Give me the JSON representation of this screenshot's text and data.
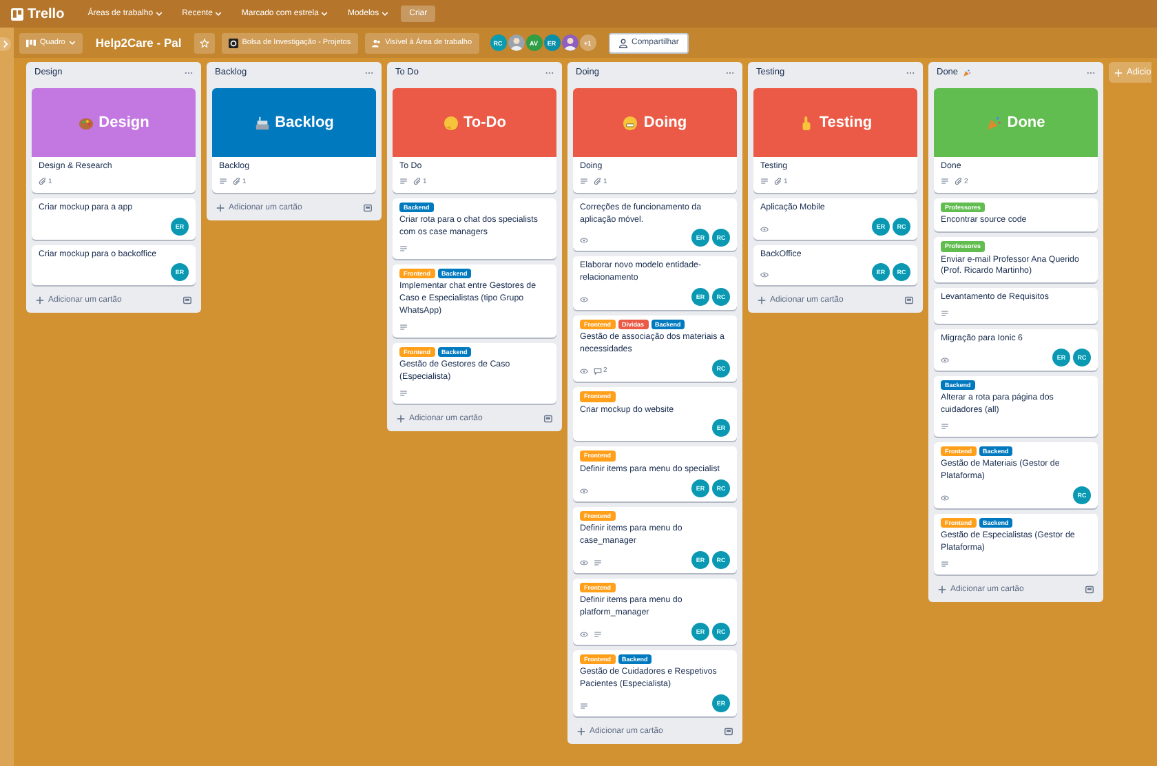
{
  "topbar": {
    "logo": "Trello",
    "menus": [
      {
        "label": "Áreas de trabalho"
      },
      {
        "label": "Recente"
      },
      {
        "label": "Marcado com estrela"
      },
      {
        "label": "Modelos"
      }
    ],
    "create": "Criar"
  },
  "boardbar": {
    "view": "Quadro",
    "title": "Help2Care - Pal",
    "starred": false,
    "workspace": "Bolsa de Investigação - Projetos",
    "visibility": "Visível à Área de trabalho",
    "members": [
      {
        "kind": "initials",
        "initials": "RC",
        "color": "#0a9bb0"
      },
      {
        "kind": "photo",
        "color": "#9aa3ad"
      },
      {
        "kind": "initials",
        "initials": "AV",
        "color": "#2f9e44"
      },
      {
        "kind": "initials",
        "initials": "ER",
        "color": "#0a8fa8"
      },
      {
        "kind": "photo",
        "color": "#8e5fc0"
      }
    ],
    "more": "+1",
    "share": "Compartilhar"
  },
  "lists": [
    {
      "title": "Design",
      "add": "Adicionar um cartão",
      "cards": [
        {
          "cover": {
            "color": "#c377e0",
            "title": "Design"
          },
          "title": "Design & Research",
          "badges": [
            {
              "kind": "attachments",
              "count": "1"
            }
          ]
        },
        {
          "title": "Criar mockup para a app",
          "members": [
            "ER"
          ]
        },
        {
          "title": "Criar mockup para o backoffice",
          "members": [
            "ER"
          ]
        }
      ]
    },
    {
      "title": "Backlog",
      "add": "Adicionar um cartão",
      "cards": [
        {
          "cover": {
            "color": "#0079bf",
            "title": "Backlog"
          },
          "title": "Backlog",
          "badges": [
            {
              "kind": "description"
            },
            {
              "kind": "attachments",
              "count": "1"
            }
          ]
        }
      ]
    },
    {
      "title": "To Do",
      "add": "Adicionar um cartão",
      "cards": [
        {
          "cover": {
            "color": "#eb5a46",
            "title": "To-Do"
          },
          "title": "To Do",
          "badges": [
            {
              "kind": "description"
            },
            {
              "kind": "attachments",
              "count": "1"
            }
          ]
        },
        {
          "labels": [
            {
              "text": "Backend",
              "color": "#0079bf"
            }
          ],
          "title": "Criar rota para o chat dos specialists com os case managers",
          "badges": [
            {
              "kind": "description"
            }
          ]
        },
        {
          "labels": [
            {
              "text": "Frontend",
              "color": "#ff9f1a"
            },
            {
              "text": "Backend",
              "color": "#0079bf"
            }
          ],
          "title": "Implementar chat entre Gestores de Caso e Especialistas (tipo Grupo WhatsApp)",
          "badges": [
            {
              "kind": "description"
            }
          ]
        },
        {
          "labels": [
            {
              "text": "Frontend",
              "color": "#ff9f1a"
            },
            {
              "text": "Backend",
              "color": "#0079bf"
            }
          ],
          "title": "Gestão de Gestores de Caso (Especialista)",
          "badges": [
            {
              "kind": "description"
            }
          ]
        }
      ]
    },
    {
      "title": "Doing",
      "add": "Adicionar um cartão",
      "cards": [
        {
          "cover": {
            "color": "#eb5a46",
            "title": "Doing"
          },
          "title": "Doing",
          "badges": [
            {
              "kind": "description"
            },
            {
              "kind": "attachments",
              "count": "1"
            }
          ]
        },
        {
          "title": "Correções de funcionamento da aplicação móvel.",
          "badges": [
            {
              "kind": "watch"
            }
          ],
          "members": [
            "ER",
            "RC"
          ]
        },
        {
          "title": "Elaborar novo modelo entidade-relacionamento",
          "badges": [
            {
              "kind": "watch"
            }
          ],
          "members": [
            "ER",
            "RC"
          ]
        },
        {
          "labels": [
            {
              "text": "Frontend",
              "color": "#ff9f1a"
            },
            {
              "text": "Dívidas",
              "color": "#eb5a46"
            },
            {
              "text": "Backend",
              "color": "#0079bf"
            }
          ],
          "title": "Gestão de associação dos materiais a necessidades",
          "badges": [
            {
              "kind": "watch"
            },
            {
              "kind": "comments",
              "count": "2"
            }
          ],
          "members": [
            "RC"
          ]
        },
        {
          "labels": [
            {
              "text": "Frontend",
              "color": "#ff9f1a"
            }
          ],
          "title": "Criar mockup do website",
          "members": [
            "ER"
          ]
        },
        {
          "labels": [
            {
              "text": "Frontend",
              "color": "#ff9f1a"
            }
          ],
          "title": "Definir items para menu do specialist",
          "badges": [
            {
              "kind": "watch"
            }
          ],
          "members": [
            "ER",
            "RC"
          ]
        },
        {
          "labels": [
            {
              "text": "Frontend",
              "color": "#ff9f1a"
            }
          ],
          "title": "Definir items para menu do case_manager",
          "badges": [
            {
              "kind": "watch"
            },
            {
              "kind": "description"
            }
          ],
          "members": [
            "ER",
            "RC"
          ]
        },
        {
          "labels": [
            {
              "text": "Frontend",
              "color": "#ff9f1a"
            }
          ],
          "title": "Definir items para menu do platform_manager",
          "badges": [
            {
              "kind": "watch"
            },
            {
              "kind": "description"
            }
          ],
          "members": [
            "ER",
            "RC"
          ]
        },
        {
          "labels": [
            {
              "text": "Frontend",
              "color": "#ff9f1a"
            },
            {
              "text": "Backend",
              "color": "#0079bf"
            }
          ],
          "title": "Gestão de Cuidadores e Respetivos Pacientes (Especialista)",
          "badges": [
            {
              "kind": "description"
            }
          ],
          "members": [
            "ER"
          ]
        }
      ]
    },
    {
      "title": "Testing",
      "add": "Adicionar um cartão",
      "cards": [
        {
          "cover": {
            "color": "#eb5a46",
            "title": "Testing"
          },
          "title": "Testing",
          "badges": [
            {
              "kind": "description"
            },
            {
              "kind": "attachments",
              "count": "1"
            }
          ]
        },
        {
          "title": "Aplicação Mobile",
          "badges": [
            {
              "kind": "watch"
            }
          ],
          "members": [
            "ER",
            "RC"
          ]
        },
        {
          "title": "BackOffice",
          "badges": [
            {
              "kind": "watch"
            }
          ],
          "members": [
            "ER",
            "RC"
          ]
        }
      ]
    },
    {
      "title": "Done",
      "title_icon": true,
      "add": "Adicionar um cartão",
      "cards": [
        {
          "cover": {
            "color": "#61bd4f",
            "title": "Done"
          },
          "title": "Done",
          "badges": [
            {
              "kind": "description"
            },
            {
              "kind": "attachments",
              "count": "2"
            }
          ]
        },
        {
          "labels": [
            {
              "text": "Professores",
              "color": "#61bd4f"
            }
          ],
          "title": "Encontrar source code"
        },
        {
          "labels": [
            {
              "text": "Professores",
              "color": "#61bd4f"
            }
          ],
          "title": "Enviar e-mail Professor Ana Querido (Prof. Ricardo Martinho)"
        },
        {
          "title": "Levantamento de Requisitos",
          "badges": [
            {
              "kind": "description"
            }
          ]
        },
        {
          "title": "Migração para Ionic 6",
          "badges": [
            {
              "kind": "watch"
            }
          ],
          "members": [
            "ER",
            "RC"
          ]
        },
        {
          "labels": [
            {
              "text": "Backend",
              "color": "#0079bf"
            }
          ],
          "title": "Alterar a rota para página dos cuidadores (all)",
          "badges": [
            {
              "kind": "description"
            }
          ]
        },
        {
          "labels": [
            {
              "text": "Frontend",
              "color": "#ff9f1a"
            },
            {
              "text": "Backend",
              "color": "#0079bf"
            }
          ],
          "title": "Gestão de Materiais (Gestor de Plataforma)",
          "badges": [
            {
              "kind": "watch"
            }
          ],
          "members": [
            "RC"
          ]
        },
        {
          "labels": [
            {
              "text": "Frontend",
              "color": "#ff9f1a"
            },
            {
              "text": "Backend",
              "color": "#0079bf"
            }
          ],
          "title": "Gestão de Especialistas (Gestor de Plataforma)",
          "badges": [
            {
              "kind": "description"
            }
          ]
        }
      ]
    }
  ],
  "add_list": "Adicio"
}
